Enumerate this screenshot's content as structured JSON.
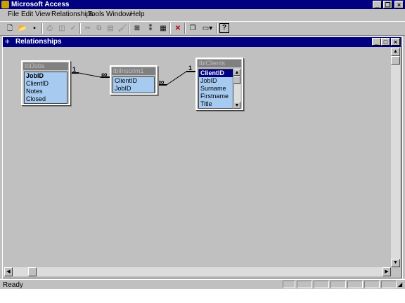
{
  "app": {
    "title": "Microsoft Access"
  },
  "menu": [
    "File",
    "Edit",
    "View",
    "Relationships",
    "Tools",
    "Window",
    "Help"
  ],
  "toolbar_icons": [
    "new-icon",
    "open-icon",
    "save-icon",
    "print-icon",
    "print-preview-icon",
    "spelling-icon",
    "cut-icon",
    "copy-icon",
    "paste-icon",
    "format-painter-icon",
    "show-table-icon",
    "show-direct-icon",
    "show-all-icon",
    "delete-icon",
    "new-object-icon",
    "database-window-icon",
    "help-icon"
  ],
  "window": {
    "title": "Relationships"
  },
  "tables": [
    {
      "name": "tblJobs",
      "fields": [
        {
          "label": "JobID",
          "key": true
        },
        {
          "label": "ClientID"
        },
        {
          "label": "Notes"
        },
        {
          "label": "Closed"
        }
      ]
    },
    {
      "name": "tblInscrim1",
      "fields": [
        {
          "label": "ClientID"
        },
        {
          "label": "JobID"
        }
      ]
    },
    {
      "name": "tblClients",
      "fields": [
        {
          "label": "ClientID",
          "key": true,
          "selected": true
        },
        {
          "label": "JobID"
        },
        {
          "label": "Surname"
        },
        {
          "label": "Firstname"
        },
        {
          "label": "Title"
        }
      ]
    }
  ],
  "relationships": [
    {
      "one": "1",
      "many": "∞"
    },
    {
      "one": "1",
      "many": "∞"
    }
  ],
  "status": {
    "text": "Ready"
  }
}
